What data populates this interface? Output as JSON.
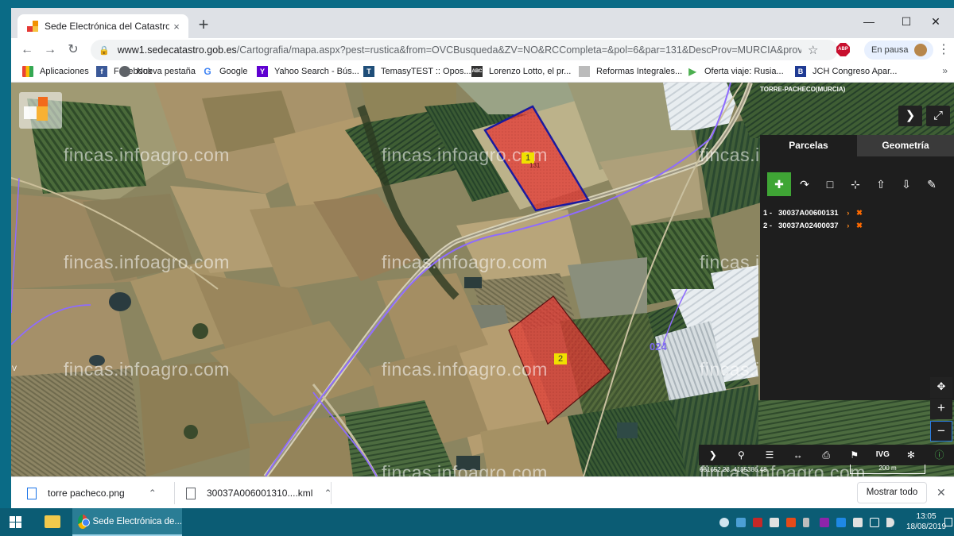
{
  "browser": {
    "tab_title": "Sede Electrónica del Catastro",
    "tab_close": "×",
    "new_tab": "+",
    "window_minimize": "—",
    "window_maximize": "☐",
    "window_close": "✕",
    "url_host": "www1.sedecatastro.gob.es",
    "url_path": "/Cartografia/mapa.aspx?pest=rustica&from=OVCBusqueda&ZV=NO&RCCompleta=&pol=6&par=131&DescProv=MURCIA&prov...",
    "abp_label": "ABP",
    "profile_label": "En pausa"
  },
  "bookmarks": [
    {
      "label": "Aplicaciones",
      "icon": "apps-grid-icon",
      "color": "#ea4335"
    },
    {
      "label": "Facebook",
      "icon": "facebook-icon",
      "color": "#3b5998"
    },
    {
      "label": "Nueva pestaña",
      "icon": "globe-icon",
      "color": "#5f6368"
    },
    {
      "label": "Google",
      "icon": "google-icon",
      "color": "#4285f4"
    },
    {
      "label": "Yahoo Search - Bús...",
      "icon": "yahoo-icon",
      "color": "#5f01d1"
    },
    {
      "label": "TemasyTEST :: Opos...",
      "icon": "temasytest-icon",
      "color": "#1f4e79"
    },
    {
      "label": "Lorenzo Lotto, el pr...",
      "icon": "abc-icon",
      "color": "#333333"
    },
    {
      "label": "Reformas Integrales...",
      "icon": "reformas-icon",
      "color": "#888888"
    },
    {
      "label": "Oferta viaje: Rusia...",
      "icon": "play-icon",
      "color": "#4caf50"
    },
    {
      "label": "JCH Congreso Apar...",
      "icon": "b-icon",
      "color": "#1f3a93"
    }
  ],
  "map": {
    "town_label": "TORRE-PACHECO(MURCIA)",
    "watermark": "fincas.infoagro.com",
    "parcel_labels": [
      "1",
      "2"
    ],
    "parcel_subtext": "131",
    "road_label": "024",
    "coordinates": "681652.28, 4185386.48",
    "scale_label": "200 m",
    "left_marker": "V"
  },
  "panel": {
    "tab_parcelas": "Parcelas",
    "tab_geometria": "Geometría",
    "parcels": [
      {
        "index": "1 -",
        "ref": "30037A00600131"
      },
      {
        "index": "2 -",
        "ref": "30037A02400037"
      }
    ],
    "arrow": "›",
    "remove": "✖",
    "tool_icons": [
      "add-parcel-icon",
      "select-parcel-icon",
      "add-area-icon",
      "add-point-icon",
      "upload-icon",
      "download-icon",
      "edit-icon"
    ],
    "toolbar_ivg": "IVG"
  },
  "downloads": {
    "files": [
      {
        "name": "torre pacheco.png"
      },
      {
        "name": "30037A006001310....kml"
      }
    ],
    "show_all": "Mostrar todo"
  },
  "taskbar": {
    "chrome_label": "Sede Electrónica de...",
    "time": "13:05",
    "date": "18/08/2019"
  },
  "colors": {
    "parcel_fill": "#e53935",
    "parcel_selected_stroke": "#1a1aa0",
    "tool_selected": "#3fa535",
    "accent_orange": "#ff8a1f"
  }
}
